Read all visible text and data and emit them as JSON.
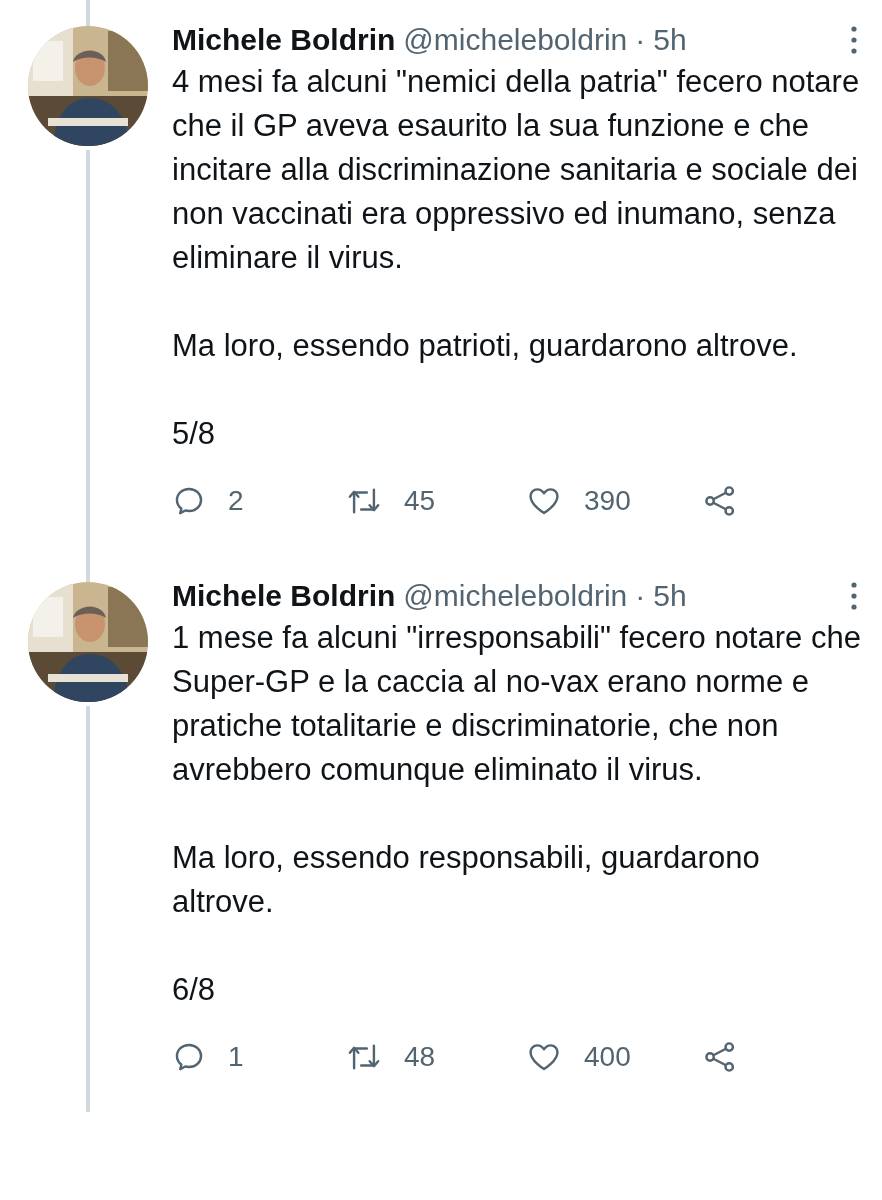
{
  "tweets": [
    {
      "author": "Michele Boldrin",
      "handle": "@micheleboldrin",
      "separator": "·",
      "time": "5h",
      "connected_above": true,
      "connected_below": true,
      "paragraphs": [
        "4 mesi fa alcuni \"nemici della patria\" fecero notare che il GP aveva esaurito la sua funzione e che incitare alla discriminazione sanitaria e sociale dei non vaccinati era oppressivo ed inumano, senza eliminare il virus.",
        "Ma loro, essendo patrioti, guardarono altrove.",
        "5/8"
      ],
      "replies": "2",
      "retweets": "45",
      "likes": "390"
    },
    {
      "author": "Michele Boldrin",
      "handle": "@micheleboldrin",
      "separator": "·",
      "time": "5h",
      "connected_above": true,
      "connected_below": true,
      "paragraphs": [
        "1 mese fa alcuni \"irresponsabili\" fecero notare che Super-GP e la caccia al no-vax erano norme e pratiche totalitarie e discriminatorie, che non avrebbero comunque eliminato il virus.",
        "Ma loro, essendo responsabili, guardarono altrove.",
        "6/8"
      ],
      "replies": "1",
      "retweets": "48",
      "likes": "400"
    }
  ]
}
